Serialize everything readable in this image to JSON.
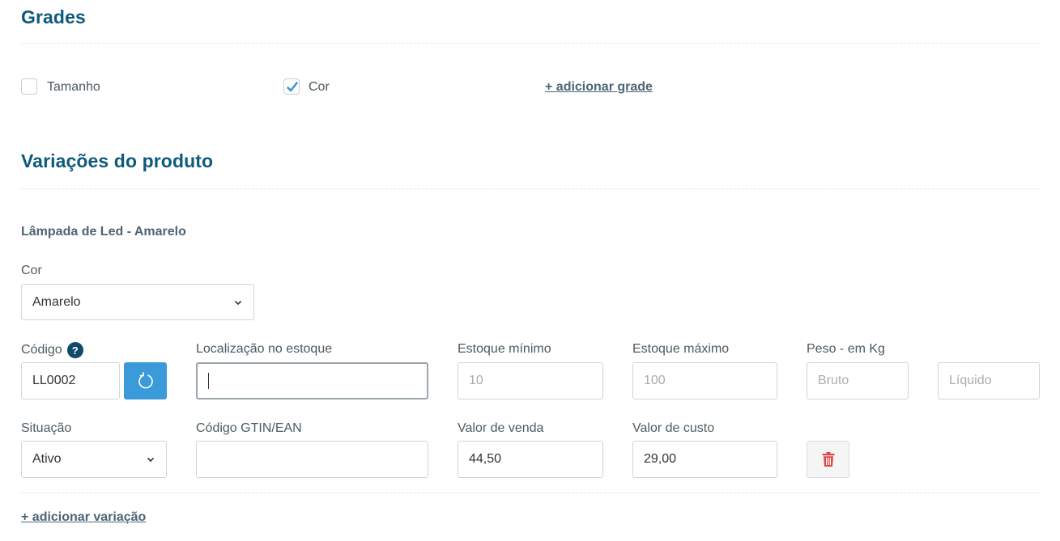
{
  "grades": {
    "title": "Grades",
    "options": [
      {
        "label": "Tamanho",
        "checked": false
      },
      {
        "label": "Cor",
        "checked": true
      }
    ],
    "add_link": "+ adicionar grade"
  },
  "variations": {
    "title": "Variações do produto",
    "item": {
      "name": "Lâmpada de Led - Amarelo",
      "cor": {
        "label": "Cor",
        "value": "Amarelo"
      },
      "codigo": {
        "label": "Código",
        "help": "?",
        "value": "LL0002"
      },
      "localizacao": {
        "label": "Localização no estoque",
        "value": ""
      },
      "estoque_minimo": {
        "label": "Estoque mínimo",
        "placeholder": "10"
      },
      "estoque_maximo": {
        "label": "Estoque máximo",
        "placeholder": "100"
      },
      "peso": {
        "label": "Peso - em Kg",
        "bruto_placeholder": "Bruto",
        "liquido_placeholder": "Líquido"
      },
      "situacao": {
        "label": "Situação",
        "value": "Ativo"
      },
      "gtin": {
        "label": "Código GTIN/EAN",
        "value": ""
      },
      "valor_venda": {
        "label": "Valor de venda",
        "value": "44,50"
      },
      "valor_custo": {
        "label": "Valor de custo",
        "value": "29,00"
      }
    },
    "add_link": "+ adicionar variação"
  },
  "colors": {
    "title": "#0f5a7c",
    "accent_button": "#3b9ad9",
    "checkmark": "#3b9ad9",
    "trash": "#e04848"
  }
}
